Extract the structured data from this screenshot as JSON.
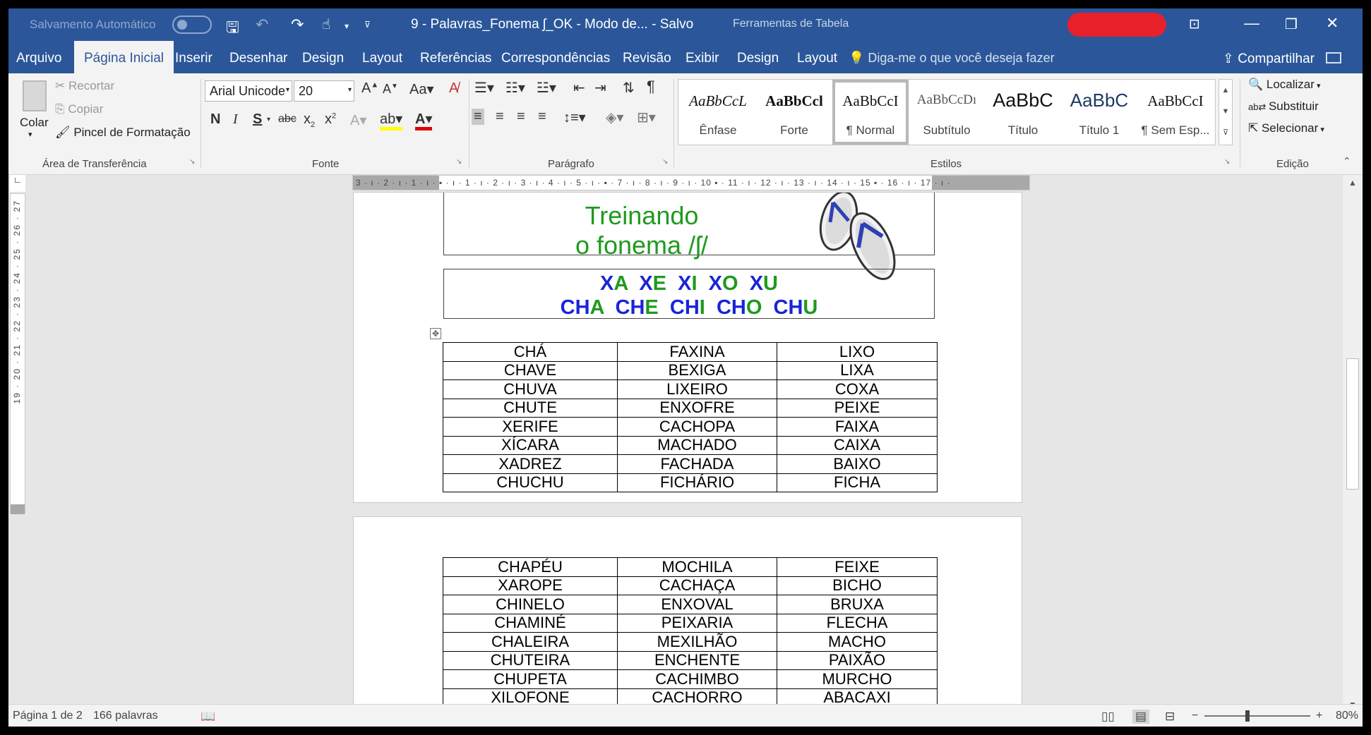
{
  "titlebar": {
    "autosave_label": "Salvamento Automático",
    "document_title": "9 - Palavras_Fonema ʃ_OK  -  Modo de...  -  Salvo",
    "tools_label": "Ferramentas de Tabela"
  },
  "tabs": [
    "Arquivo",
    "Página Inicial",
    "Inserir",
    "Desenhar",
    "Design",
    "Layout",
    "Referências",
    "Correspondências",
    "Revisão",
    "Exibir",
    "Design",
    "Layout"
  ],
  "tell_me": "Diga-me o que você deseja fazer",
  "share": "Compartilhar",
  "clipboard": {
    "paste": "Colar",
    "cut": "Recortar",
    "copy": "Copiar",
    "format_painter": "Pincel de Formatação",
    "group_label": "Área de Transferência"
  },
  "font": {
    "name": "Arial Unicode",
    "size": "20",
    "group_label": "Fonte",
    "bold": "N",
    "italic": "I",
    "underline": "S",
    "strike": "abc"
  },
  "paragraph": {
    "group_label": "Parágrafo"
  },
  "styles": {
    "group_label": "Estilos",
    "items": [
      {
        "sample": "AaBbCcL",
        "name": "Ênfase"
      },
      {
        "sample": "AaBbCcl",
        "name": "Forte"
      },
      {
        "sample": "AaBbCcI",
        "name": "¶ Normal"
      },
      {
        "sample": "AaBbCcDı",
        "name": "Subtítulo"
      },
      {
        "sample": "AaBbC",
        "name": "Título"
      },
      {
        "sample": "AaBbC",
        "name": "Título 1"
      },
      {
        "sample": "AaBbCcI",
        "name": "¶ Sem Esp..."
      }
    ]
  },
  "editing": {
    "group_label": "Edição",
    "find": "Localizar",
    "replace": "Substituir",
    "select": "Selecionar"
  },
  "ruler": {
    "h_text": "3 · ı · 2 · ı · 1 · ı ·  ▪  · ı · 1 · ı · 2 · ı · 3 · ı · 4 · ı · 5 · ı ·  ▪  · 7 · ı · 8 · ı · 9 · ı · 10 ▪ · 11 · ı · 12 · ı · 13 · ı · 14 · ı · 15 ▪ · 16 · ı · 17 · ı ·",
    "v_text": "19 · 20 · 21 · 22 · 23 · 24 · 25 · 26 · 27"
  },
  "document": {
    "title_line1": "Treinando",
    "title_line2": "o fonema /ʃ/",
    "syllables_row1": [
      {
        "t": "X",
        "c": "b"
      },
      {
        "t": "A",
        "c": "g"
      },
      {
        "t": "  ",
        "c": "b"
      },
      {
        "t": "X",
        "c": "b"
      },
      {
        "t": "E",
        "c": "g"
      },
      {
        "t": "  ",
        "c": "b"
      },
      {
        "t": "X",
        "c": "b"
      },
      {
        "t": "I",
        "c": "g"
      },
      {
        "t": "  ",
        "c": "b"
      },
      {
        "t": "X",
        "c": "b"
      },
      {
        "t": "O",
        "c": "g"
      },
      {
        "t": "  ",
        "c": "b"
      },
      {
        "t": "X",
        "c": "b"
      },
      {
        "t": "U",
        "c": "g"
      }
    ],
    "syllables_row2": [
      {
        "t": "CH",
        "c": "b"
      },
      {
        "t": "A",
        "c": "g"
      },
      {
        "t": "  ",
        "c": "b"
      },
      {
        "t": "CH",
        "c": "b"
      },
      {
        "t": "E",
        "c": "g"
      },
      {
        "t": "  ",
        "c": "b"
      },
      {
        "t": "CH",
        "c": "b"
      },
      {
        "t": "I",
        "c": "g"
      },
      {
        "t": "  ",
        "c": "b"
      },
      {
        "t": "CH",
        "c": "b"
      },
      {
        "t": "O",
        "c": "g"
      },
      {
        "t": "  ",
        "c": "b"
      },
      {
        "t": "CH",
        "c": "b"
      },
      {
        "t": "U",
        "c": "g"
      }
    ],
    "table1": [
      [
        "CHÁ",
        "FAXINA",
        "LIXO"
      ],
      [
        "CHAVE",
        "BEXIGA",
        "LIXA"
      ],
      [
        "CHUVA",
        "LIXEIRO",
        "COXA"
      ],
      [
        "CHUTE",
        "ENXOFRE",
        "PEIXE"
      ],
      [
        "XERIFE",
        "CACHOPA",
        "FAIXA"
      ],
      [
        "XÍCARA",
        "MACHADO",
        "CAIXA"
      ],
      [
        "XADREZ",
        "FACHADA",
        "BAIXO"
      ],
      [
        "CHUCHU",
        "FICHÁRIO",
        "FICHA"
      ]
    ],
    "table2": [
      [
        "CHAPÉU",
        "MOCHILA",
        "FEIXE"
      ],
      [
        "XAROPE",
        "CACHAÇA",
        "BICHO"
      ],
      [
        "CHINELO",
        "ENXOVAL",
        "BRUXA"
      ],
      [
        "CHAMINÉ",
        "PEIXARIA",
        "FLECHA"
      ],
      [
        "CHALEIRA",
        "MEXILHÃO",
        "MACHO"
      ],
      [
        "CHUTEIRA",
        "ENCHENTE",
        "PAIXÃO"
      ],
      [
        "CHUPETA",
        "CACHIMBO",
        "MURCHO"
      ],
      [
        "XILOFONE",
        "CACHORRO",
        "ABACAXI"
      ]
    ]
  },
  "status": {
    "page": "Página 1 de 2",
    "words": "166 palavras",
    "zoom": "80%"
  },
  "colors": {
    "word_blue": "#2b579a",
    "title_green": "#1f9a1f",
    "syllable_blue": "#1a25d6"
  }
}
